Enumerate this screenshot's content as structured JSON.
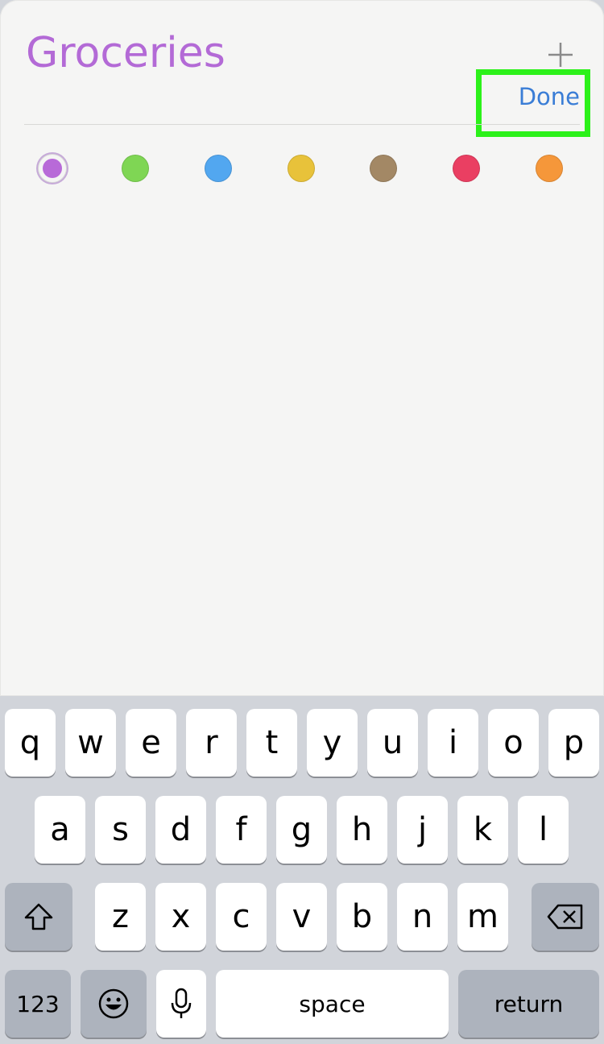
{
  "list": {
    "title": "Groceries",
    "done_label": "Done",
    "add_icon": "plus-icon",
    "title_color": "#b36ad6",
    "accent_color": "#3a7dd6",
    "highlight_color": "#2cf11a"
  },
  "colors": [
    {
      "name": "purple",
      "hex": "#b86ad8",
      "selected": true
    },
    {
      "name": "green",
      "hex": "#7fd654",
      "selected": false
    },
    {
      "name": "blue",
      "hex": "#52a7f0",
      "selected": false
    },
    {
      "name": "yellow",
      "hex": "#e8c23a",
      "selected": false
    },
    {
      "name": "brown",
      "hex": "#a38865",
      "selected": false
    },
    {
      "name": "red",
      "hex": "#ea3f62",
      "selected": false
    },
    {
      "name": "orange",
      "hex": "#f5973a",
      "selected": false
    }
  ],
  "keyboard": {
    "row1": [
      "q",
      "w",
      "e",
      "r",
      "t",
      "y",
      "u",
      "i",
      "o",
      "p"
    ],
    "row2": [
      "a",
      "s",
      "d",
      "f",
      "g",
      "h",
      "j",
      "k",
      "l"
    ],
    "row3": [
      "z",
      "x",
      "c",
      "v",
      "b",
      "n",
      "m"
    ],
    "numbers_label": "123",
    "space_label": "space",
    "return_label": "return",
    "shift_icon": "shift-icon",
    "delete_icon": "delete-icon",
    "emoji_icon": "emoji-icon",
    "mic_icon": "microphone-icon"
  }
}
